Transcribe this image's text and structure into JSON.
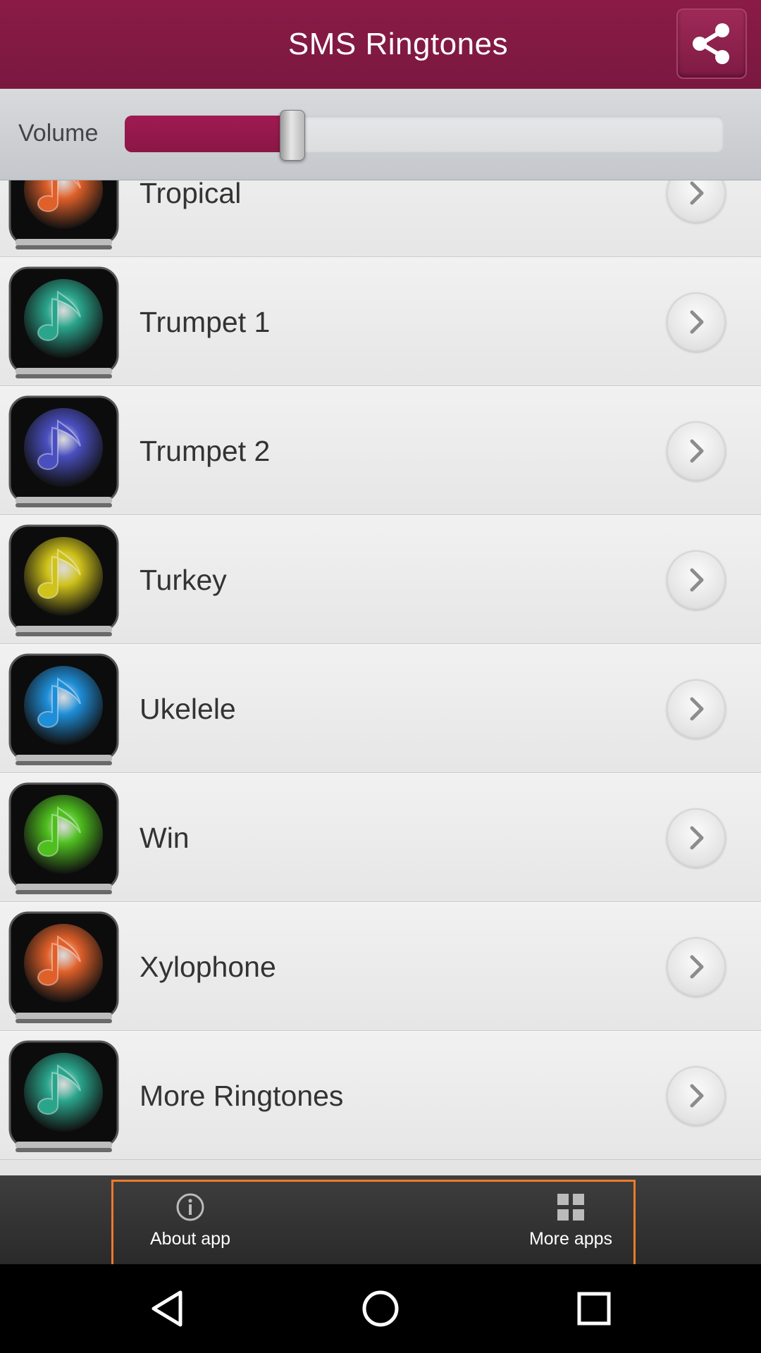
{
  "header": {
    "title": "SMS Ringtones",
    "share_icon": "share-icon"
  },
  "volume": {
    "label": "Volume",
    "level_percent": 28,
    "accent": "#8a1745"
  },
  "list": {
    "items": [
      {
        "label": "Tropical",
        "icon": "music-note-icon",
        "color": "#e0602a"
      },
      {
        "label": "Trumpet 1",
        "icon": "music-note-icon",
        "color": "#2aa58c"
      },
      {
        "label": "Trumpet 2",
        "icon": "music-note-icon",
        "color": "#4a4fc0"
      },
      {
        "label": "Turkey",
        "icon": "music-note-icon",
        "color": "#cfc21a"
      },
      {
        "label": "Ukelele",
        "icon": "music-note-icon",
        "color": "#1f8ed8"
      },
      {
        "label": "Win",
        "icon": "music-note-icon",
        "color": "#4fbf1f"
      },
      {
        "label": "Xylophone",
        "icon": "music-note-icon",
        "color": "#e0602a"
      },
      {
        "label": "More Ringtones",
        "icon": "music-note-icon",
        "color": "#2aa58c"
      }
    ],
    "chevron_icon": "chevron-right-icon"
  },
  "bottom_bar": {
    "about_label": "About app",
    "about_icon": "info-icon",
    "more_label": "More apps",
    "more_icon": "grid-icon",
    "highlight_color": "#f07a2a"
  },
  "nav": {
    "back_icon": "back-icon",
    "home_icon": "home-icon",
    "recents_icon": "recents-icon"
  }
}
